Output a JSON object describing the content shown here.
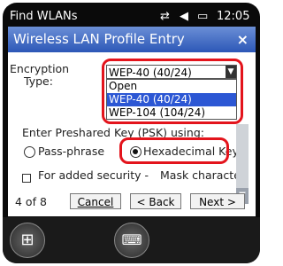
{
  "status_bar": {
    "title": "Find WLANs",
    "connectivity_icon": "sync-icon",
    "volume_icon": "speaker-icon",
    "battery_icon": "battery-icon",
    "time": "12:05"
  },
  "dialog": {
    "title": "Wireless LAN Profile Entry",
    "close": "×",
    "encryption_label_line1": "Encryption",
    "encryption_label_line2": "Type:",
    "encryption_selected": "WEP-40 (40/24)",
    "encryption_options": [
      "Open",
      "WEP-40 (40/24)",
      "WEP-104 (104/24)"
    ],
    "psk_label": "Enter Preshared Key (PSK) using:",
    "radio_passphrase": "Pass-phrase",
    "radio_hex": "Hexadecimal Keys",
    "radio_selected": "Hexadecimal Keys",
    "added_security": "For added security -",
    "mask_characters": "Mask characte",
    "page_indicator": "4 of 8",
    "cancel": "Cancel",
    "back": "< Back",
    "next": "Next >"
  },
  "bottom_bar": {
    "start_icon": "windows-logo-icon",
    "keyboard_icon": "keyboard-icon"
  },
  "highlight_color": "#e3141c",
  "title_bar_color": "#2c57b7"
}
